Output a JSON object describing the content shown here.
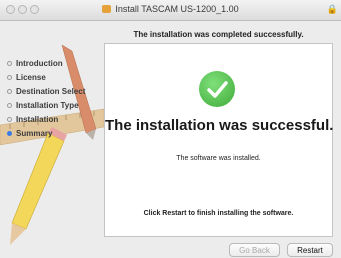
{
  "window": {
    "title": "Install TASCAM US-1200_1.00",
    "icon": "package-icon"
  },
  "status_message": "The installation was completed successfully.",
  "sidebar": {
    "steps": [
      {
        "label": "Introduction",
        "active": false
      },
      {
        "label": "License",
        "active": false
      },
      {
        "label": "Destination Select",
        "active": false
      },
      {
        "label": "Installation Type",
        "active": false
      },
      {
        "label": "Installation",
        "active": false
      },
      {
        "label": "Summary",
        "active": true
      }
    ]
  },
  "panel": {
    "icon": "checkmark-circle-icon",
    "headline": "The installation was successful.",
    "subtext": "The software was installed.",
    "hint": "Click Restart to finish installing the software."
  },
  "buttons": {
    "back_label": "Go Back",
    "restart_label": "Restart"
  },
  "colors": {
    "accent": "#3a7ae4",
    "success": "#4cbb47"
  }
}
